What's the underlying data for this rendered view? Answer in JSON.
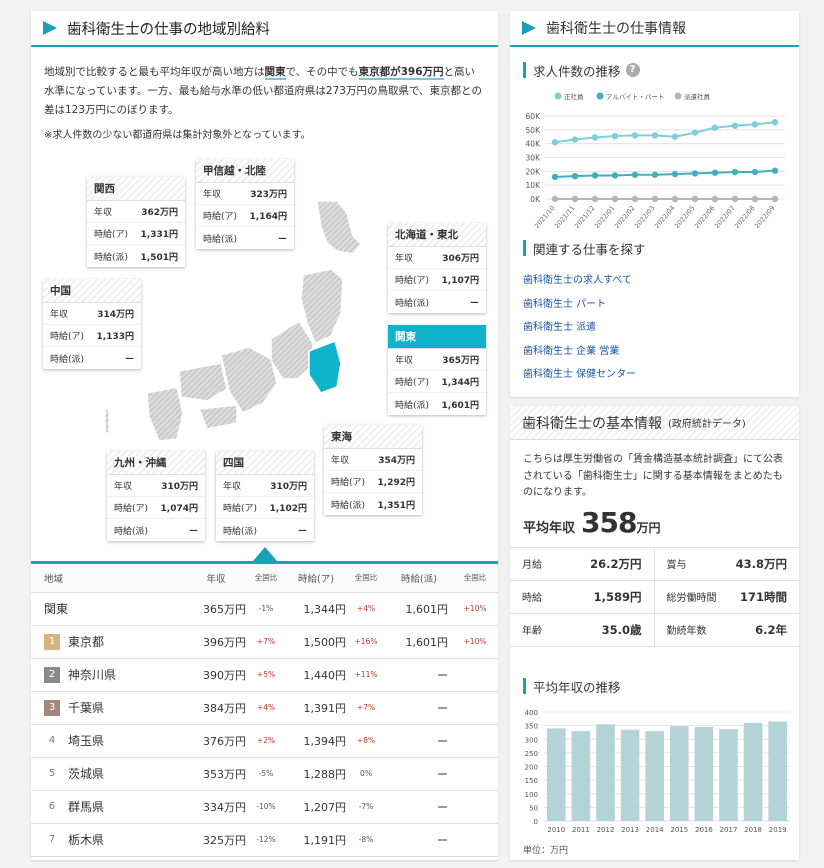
{
  "left": {
    "title": "歯科衛生士の仕事の地域別給料",
    "desc_parts": [
      "地域別で比較すると最も平均年収が高い地方は",
      "関東",
      "で、その中でも",
      "東京都が396万円",
      "と高い水準になっています。一方、最も給与水準の低い都道府県は273万円の鳥取県で、東京都との差は123万円にのぼります。"
    ],
    "note": "※求人件数の少ない都道府県は集計対象外となっています。",
    "regions": [
      {
        "name": "関西",
        "annual": "362万円",
        "part": "1,331円",
        "dispatch": "1,501円"
      },
      {
        "name": "甲信越・北陸",
        "annual": "323万円",
        "part": "1,164円",
        "dispatch": "ー"
      },
      {
        "name": "北海道・東北",
        "annual": "306万円",
        "part": "1,107円",
        "dispatch": "ー"
      },
      {
        "name": "中国",
        "annual": "314万円",
        "part": "1,133円",
        "dispatch": "ー"
      },
      {
        "name": "関東",
        "annual": "365万円",
        "part": "1,344円",
        "dispatch": "1,601円"
      },
      {
        "name": "東海",
        "annual": "354万円",
        "part": "1,292円",
        "dispatch": "1,351円"
      },
      {
        "name": "九州・沖縄",
        "annual": "310万円",
        "part": "1,074円",
        "dispatch": "ー"
      },
      {
        "name": "四国",
        "annual": "310万円",
        "part": "1,102円",
        "dispatch": "ー"
      }
    ],
    "row_labels": {
      "annual": "年収",
      "part": "時給(ア)",
      "dispatch": "時給(派)"
    },
    "table": {
      "headers": [
        "地域",
        "年収",
        "全国比",
        "時給(ア)",
        "全国比",
        "時給(派)",
        "全国比"
      ],
      "rows": [
        {
          "rank": "",
          "name": "関東",
          "annual": "365万円",
          "a_pct": "-1%",
          "part": "1,344円",
          "p_pct": "+4%",
          "disp": "1,601円",
          "d_pct": "+10%"
        },
        {
          "rank": "1",
          "name": "東京都",
          "annual": "396万円",
          "a_pct": "+7%",
          "part": "1,500円",
          "p_pct": "+16%",
          "disp": "1,601円",
          "d_pct": "+10%"
        },
        {
          "rank": "2",
          "name": "神奈川県",
          "annual": "390万円",
          "a_pct": "+5%",
          "part": "1,440円",
          "p_pct": "+11%",
          "disp": "ー",
          "d_pct": ""
        },
        {
          "rank": "3",
          "name": "千葉県",
          "annual": "384万円",
          "a_pct": "+4%",
          "part": "1,391円",
          "p_pct": "+7%",
          "disp": "ー",
          "d_pct": ""
        },
        {
          "rank": "4",
          "name": "埼玉県",
          "annual": "376万円",
          "a_pct": "+2%",
          "part": "1,394円",
          "p_pct": "+8%",
          "disp": "ー",
          "d_pct": ""
        },
        {
          "rank": "5",
          "name": "茨城県",
          "annual": "353万円",
          "a_pct": "-5%",
          "part": "1,288円",
          "p_pct": "0%",
          "disp": "ー",
          "d_pct": ""
        },
        {
          "rank": "6",
          "name": "群馬県",
          "annual": "334万円",
          "a_pct": "-10%",
          "part": "1,207円",
          "p_pct": "-7%",
          "disp": "ー",
          "d_pct": ""
        },
        {
          "rank": "7",
          "name": "栃木県",
          "annual": "325万円",
          "a_pct": "-12%",
          "part": "1,191円",
          "p_pct": "-8%",
          "disp": "ー",
          "d_pct": ""
        }
      ]
    }
  },
  "right": {
    "title": "歯科衛生士の仕事情報",
    "trend_title": "求人件数の推移",
    "related_title": "関連する仕事を探す",
    "links": [
      "歯科衛生士の求人すべて",
      "歯科衛生士 パート",
      "歯科衛生士 派遣",
      "歯科衛生士 企業 営業",
      "歯科衛生士 保健センター"
    ],
    "basic_title": "歯科衛生士の基本情報",
    "basic_sub": "(政府統計データ)",
    "basic_desc": "こちらは厚生労働省の「賃金構造基本統計調査」にて公表されている「歯科衛生士」に関する基本情報をまとめたものになります。",
    "avg_label": "平均年収",
    "avg_value": "358",
    "avg_unit": "万円",
    "info": [
      {
        "k": "月給",
        "v": "26.2万円"
      },
      {
        "k": "賞与",
        "v": "43.8万円"
      },
      {
        "k": "時給",
        "v": "1,589円"
      },
      {
        "k": "総労働時間",
        "v": "171時間"
      },
      {
        "k": "年齢",
        "v": "35.0歳"
      },
      {
        "k": "勤続年数",
        "v": "6.2年"
      }
    ],
    "annual_trend_title": "平均年収の推移",
    "unit_note": "単位：万円"
  },
  "chart_data": [
    {
      "type": "line",
      "x": [
        "2021/10",
        "2021/11",
        "2021/12",
        "2022/01",
        "2022/02",
        "2022/03",
        "2022/04",
        "2022/05",
        "2022/06",
        "2022/07",
        "2022/08",
        "2022/09"
      ],
      "ylim": [
        0,
        60000
      ],
      "yticks": [
        "0K",
        "10K",
        "20K",
        "30K",
        "40K",
        "50K",
        "60K"
      ],
      "series": [
        {
          "name": "正社員",
          "color": "#7dcfe0",
          "values": [
            41000,
            43000,
            44500,
            45500,
            46000,
            46000,
            45000,
            48000,
            51500,
            53000,
            54000,
            55500
          ]
        },
        {
          "name": "アルバイト・パート",
          "color": "#43aebf",
          "values": [
            16000,
            16500,
            17000,
            17000,
            17500,
            17500,
            18000,
            18500,
            19000,
            19500,
            19500,
            20500
          ]
        },
        {
          "name": "派遣社員",
          "color": "#b5b5b5",
          "values": [
            0,
            0,
            0,
            0,
            0,
            0,
            0,
            0,
            0,
            0,
            0,
            0
          ]
        }
      ],
      "legend": "top"
    },
    {
      "type": "bar",
      "categories": [
        "2010",
        "2011",
        "2012",
        "2013",
        "2014",
        "2015",
        "2016",
        "2017",
        "2018",
        "2019"
      ],
      "values": [
        340,
        330,
        355,
        335,
        330,
        348,
        345,
        337,
        360,
        365
      ],
      "ylim": [
        0,
        400
      ],
      "yticks": [
        "0",
        "50",
        "100",
        "150",
        "200",
        "250",
        "300",
        "350",
        "400"
      ],
      "color": "#b4d3d6"
    }
  ]
}
